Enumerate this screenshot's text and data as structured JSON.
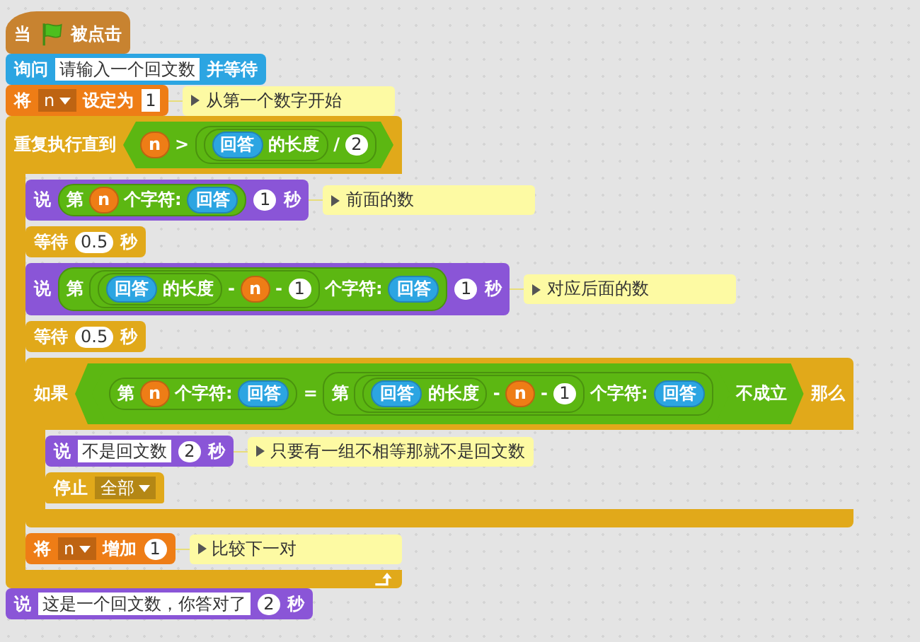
{
  "script": [
    {
      "kind": "hat",
      "color": "#c88330",
      "parts": [
        {
          "kind": "label",
          "text": "当"
        },
        {
          "kind": "flag"
        },
        {
          "kind": "label",
          "text": "被点击"
        }
      ]
    },
    {
      "kind": "stack",
      "color": "#2ca5e2",
      "parts": [
        {
          "kind": "label",
          "text": "询问"
        },
        {
          "kind": "text",
          "text": "请输入一个回文数"
        },
        {
          "kind": "label",
          "text": "并等待"
        }
      ]
    },
    {
      "kind": "stack",
      "color": "#ee7d16",
      "parts": [
        {
          "kind": "label",
          "text": "将"
        },
        {
          "kind": "dropdown",
          "text": "n"
        },
        {
          "kind": "label",
          "text": "设定为"
        },
        {
          "kind": "text",
          "text": "1"
        }
      ],
      "comment": "从第一个数字开始"
    },
    {
      "kind": "loop",
      "color": "#e1a91a",
      "parts": [
        {
          "kind": "label",
          "text": "重复执行直到"
        },
        {
          "kind": "boolean",
          "parts": [
            {
              "kind": "variable",
              "parts": [
                {
                  "kind": "label",
                  "text": "n"
                }
              ]
            },
            {
              "kind": "label",
              "text": ">"
            },
            {
              "kind": "operator",
              "parts": [
                {
                  "kind": "operator",
                  "parts": [
                    {
                      "kind": "sensing",
                      "parts": [
                        {
                          "kind": "label",
                          "text": "回答"
                        }
                      ]
                    },
                    {
                      "kind": "label",
                      "text": "的长度"
                    }
                  ]
                },
                {
                  "kind": "label",
                  "text": "/"
                },
                {
                  "kind": "number",
                  "text": "2"
                }
              ]
            }
          ]
        }
      ],
      "children": [
        {
          "kind": "stack",
          "color": "#8a55d7",
          "parts": [
            {
              "kind": "label",
              "text": "说"
            },
            {
              "kind": "operator",
              "parts": [
                {
                  "kind": "label",
                  "text": "第"
                },
                {
                  "kind": "variable",
                  "parts": [
                    {
                      "kind": "label",
                      "text": "n"
                    }
                  ]
                },
                {
                  "kind": "label",
                  "text": "个字符:"
                },
                {
                  "kind": "sensing",
                  "parts": [
                    {
                      "kind": "label",
                      "text": "回答"
                    }
                  ]
                }
              ]
            },
            {
              "kind": "number",
              "text": "1"
            },
            {
              "kind": "label",
              "text": "秒"
            }
          ],
          "comment": "前面的数"
        },
        {
          "kind": "stack",
          "color": "#e1a91a",
          "parts": [
            {
              "kind": "label",
              "text": "等待"
            },
            {
              "kind": "number",
              "text": "0.5"
            },
            {
              "kind": "label",
              "text": "秒"
            }
          ]
        },
        {
          "kind": "stack",
          "color": "#8a55d7",
          "parts": [
            {
              "kind": "label",
              "text": "说"
            },
            {
              "kind": "operator",
              "parts": [
                {
                  "kind": "label",
                  "text": "第"
                },
                {
                  "kind": "operator",
                  "parts": [
                    {
                      "kind": "operator",
                      "parts": [
                        {
                          "kind": "sensing",
                          "parts": [
                            {
                              "kind": "label",
                              "text": "回答"
                            }
                          ]
                        },
                        {
                          "kind": "label",
                          "text": "的长度"
                        }
                      ]
                    },
                    {
                      "kind": "label",
                      "text": "-"
                    },
                    {
                      "kind": "variable",
                      "parts": [
                        {
                          "kind": "label",
                          "text": "n"
                        }
                      ]
                    },
                    {
                      "kind": "label",
                      "text": "-"
                    },
                    {
                      "kind": "number",
                      "text": "1"
                    }
                  ]
                },
                {
                  "kind": "label",
                  "text": "个字符:"
                },
                {
                  "kind": "sensing",
                  "parts": [
                    {
                      "kind": "label",
                      "text": "回答"
                    }
                  ]
                }
              ]
            },
            {
              "kind": "number",
              "text": "1"
            },
            {
              "kind": "label",
              "text": "秒"
            }
          ],
          "comment": "对应后面的数"
        },
        {
          "kind": "stack",
          "color": "#e1a91a",
          "parts": [
            {
              "kind": "label",
              "text": "等待"
            },
            {
              "kind": "number",
              "text": "0.5"
            },
            {
              "kind": "label",
              "text": "秒"
            }
          ]
        },
        {
          "kind": "if",
          "color": "#e1a91a",
          "parts": [
            {
              "kind": "label",
              "text": "如果"
            },
            {
              "kind": "boolean",
              "parts": [
                {
                  "kind": "boolean",
                  "parts": [
                    {
                      "kind": "operator",
                      "parts": [
                        {
                          "kind": "label",
                          "text": "第"
                        },
                        {
                          "kind": "variable",
                          "parts": [
                            {
                              "kind": "label",
                              "text": "n"
                            }
                          ]
                        },
                        {
                          "kind": "label",
                          "text": "个字符:"
                        },
                        {
                          "kind": "sensing",
                          "parts": [
                            {
                              "kind": "label",
                              "text": "回答"
                            }
                          ]
                        }
                      ]
                    },
                    {
                      "kind": "label",
                      "text": "="
                    },
                    {
                      "kind": "operator",
                      "parts": [
                        {
                          "kind": "label",
                          "text": "第"
                        },
                        {
                          "kind": "operator",
                          "parts": [
                            {
                              "kind": "operator",
                              "parts": [
                                {
                                  "kind": "sensing",
                                  "parts": [
                                    {
                                      "kind": "label",
                                      "text": "回答"
                                    }
                                  ]
                                },
                                {
                                  "kind": "label",
                                  "text": "的长度"
                                }
                              ]
                            },
                            {
                              "kind": "label",
                              "text": "-"
                            },
                            {
                              "kind": "variable",
                              "parts": [
                                {
                                  "kind": "label",
                                  "text": "n"
                                }
                              ]
                            },
                            {
                              "kind": "label",
                              "text": "-"
                            },
                            {
                              "kind": "number",
                              "text": "1"
                            }
                          ]
                        },
                        {
                          "kind": "label",
                          "text": "个字符:"
                        },
                        {
                          "kind": "sensing",
                          "parts": [
                            {
                              "kind": "label",
                              "text": "回答"
                            }
                          ]
                        }
                      ]
                    }
                  ]
                },
                {
                  "kind": "label",
                  "text": "不成立"
                }
              ]
            },
            {
              "kind": "label",
              "text": "那么"
            }
          ],
          "children": [
            {
              "kind": "stack",
              "color": "#8a55d7",
              "parts": [
                {
                  "kind": "label",
                  "text": "说"
                },
                {
                  "kind": "text",
                  "text": "不是回文数"
                },
                {
                  "kind": "number",
                  "text": "2"
                },
                {
                  "kind": "label",
                  "text": "秒"
                }
              ],
              "comment": "只要有一组不相等那就不是回文数"
            },
            {
              "kind": "cap",
              "color": "#e1a91a",
              "parts": [
                {
                  "kind": "label",
                  "text": "停止"
                },
                {
                  "kind": "dropdown",
                  "text": "全部"
                }
              ]
            }
          ]
        },
        {
          "kind": "stack",
          "color": "#ee7d16",
          "parts": [
            {
              "kind": "label",
              "text": "将"
            },
            {
              "kind": "dropdown",
              "text": "n"
            },
            {
              "kind": "label",
              "text": "增加"
            },
            {
              "kind": "number",
              "text": "1"
            }
          ],
          "comment": "比较下一对"
        }
      ]
    },
    {
      "kind": "stack",
      "color": "#8a55d7",
      "parts": [
        {
          "kind": "label",
          "text": "说"
        },
        {
          "kind": "text",
          "text": "这是一个回文数，你答对了"
        },
        {
          "kind": "number",
          "text": "2"
        },
        {
          "kind": "label",
          "text": "秒"
        }
      ]
    }
  ]
}
